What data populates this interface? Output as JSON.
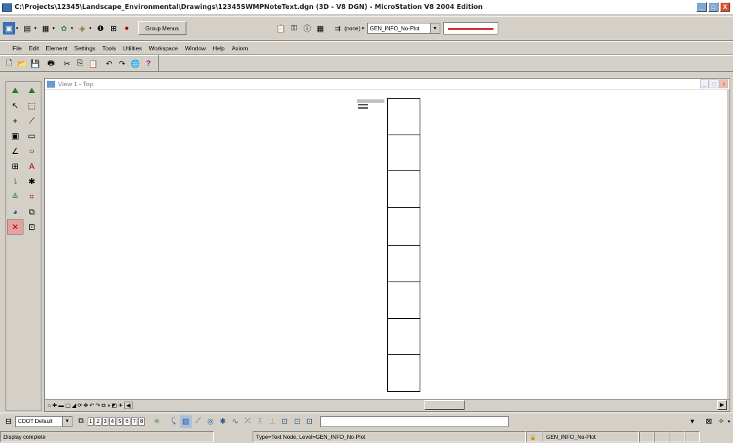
{
  "window": {
    "title": "C:\\Projects\\12345\\Landscape_Environmental\\Drawings\\12345SWMPNoteText.dgn (3D - V8 DGN) - MicroStation V8 2004 Edition",
    "min": "_",
    "max": "□",
    "close": "X"
  },
  "primary": {
    "group_menus": "Group Menus",
    "level_none": "(none)",
    "level_combo": "GEN_INFO_No-Plot"
  },
  "menu": [
    "File",
    "Edit",
    "Element",
    "Settings",
    "Tools",
    "Utilities",
    "Workspace",
    "Window",
    "Help",
    "Axiom"
  ],
  "view": {
    "title": "View 1 - Top"
  },
  "bottom": {
    "settings": "CDOT Default",
    "view_numbers": [
      "1",
      "2",
      "3",
      "4",
      "5",
      "6",
      "7",
      "8"
    ]
  },
  "status": {
    "message": "Display complete",
    "element_info": "Type=Text Node, Level=GEN_INFO_No-Plot",
    "active_level": "GEN_INFO_No-Plot"
  },
  "colors": {
    "close": "#d94f2c",
    "brand": "#3a6fb0",
    "line_style": "#cc0000"
  }
}
